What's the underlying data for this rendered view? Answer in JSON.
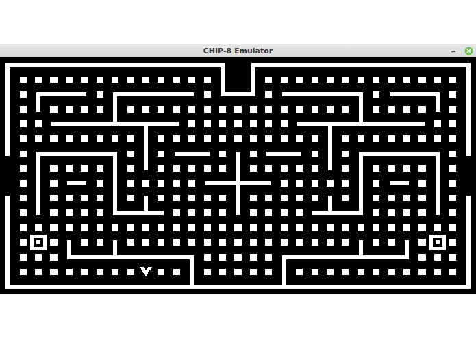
{
  "window": {
    "title": "CHIP-8 Emulator"
  },
  "display": {
    "maze": [
      "############### ###############",
      "#.............# #.............#",
      "#.####.######.###.######.####.#",
      "#.#....#...............#....#.#",
      "#..#########.......#########..#",
      "#........#...........#........#",
      "#.######.#.###.#.###.#.######.#",
      " .#....#.#.....#.....#.#....#. ",
      " .#.##.#.....#####.....#.##.#. ",
      "#.#....#.#.....#.....#.#....#.#",
      "#.#....####....#....####....#.#",
      "#.............................#",
      "#.o.#..#...............#..#.o.#",
      "#...#########.....#########...#",
      "#........P..#.....#...........#",
      "###############################"
    ]
  }
}
